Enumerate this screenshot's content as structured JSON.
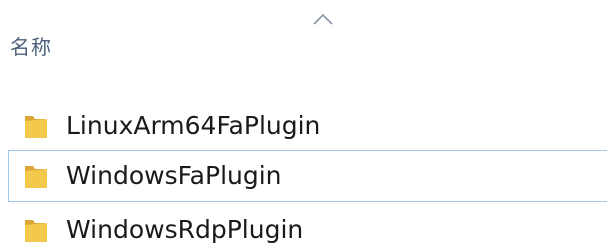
{
  "column": {
    "name_header": "名称",
    "sort_icon": "chevron-up-icon",
    "sort_direction": "ascending"
  },
  "files": [
    {
      "name": "LinuxArm64FaPlugin",
      "type": "folder",
      "icon": "folder-icon",
      "selected": false
    },
    {
      "name": "WindowsFaPlugin",
      "type": "folder",
      "icon": "folder-icon",
      "selected": true
    },
    {
      "name": "WindowsRdpPlugin",
      "type": "folder",
      "icon": "folder-icon",
      "selected": false
    }
  ],
  "colors": {
    "folder": "#f2c94c",
    "folder_shadow": "#dca737",
    "header_text": "#4c607a",
    "selection_border": "#9fc8ec"
  }
}
